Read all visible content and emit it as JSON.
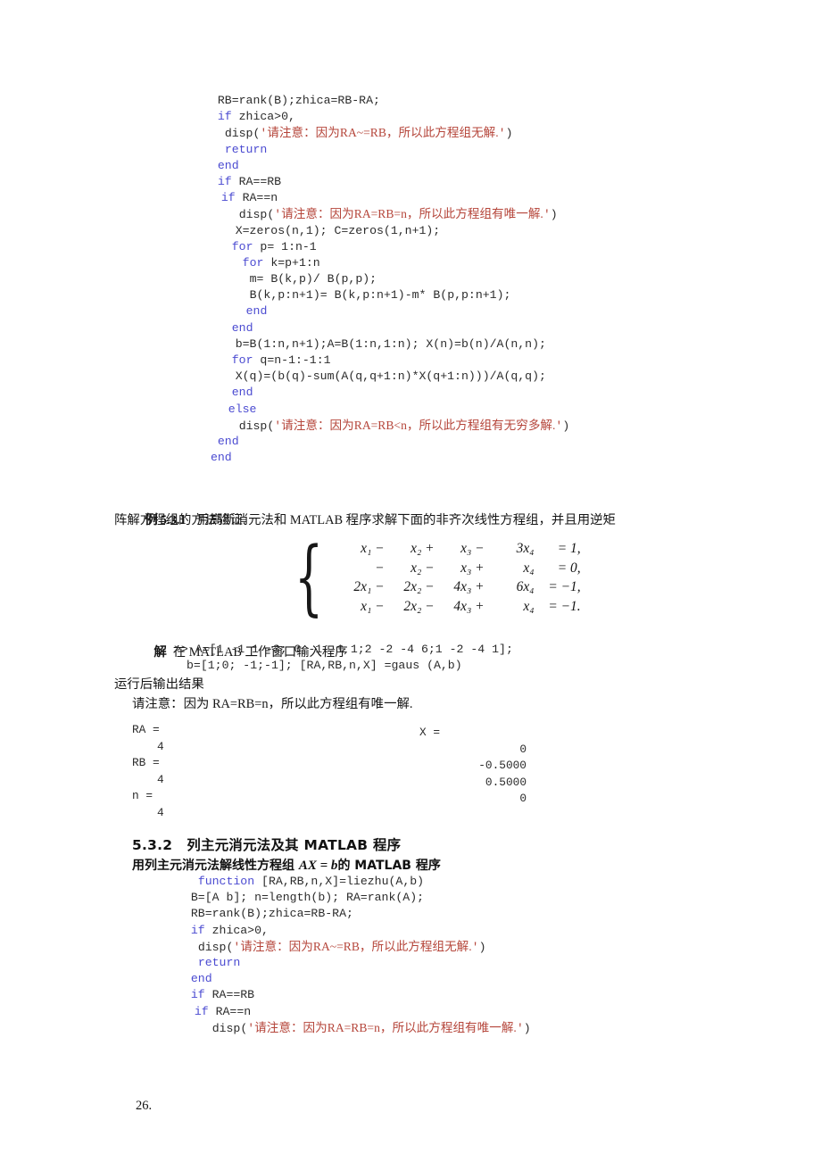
{
  "document": {
    "page_number": "26.",
    "colors": {
      "keyword_blue": "#4b4bd1",
      "string_red": "#b5453a",
      "body_text": "#161616",
      "page_background": "#ffffff"
    }
  },
  "code_block_top": {
    "name": "gauss-function-continuation",
    "lines": [
      {
        "indent": 2,
        "segments": [
          {
            "text": "RB=rank(B);zhica=RB-RA;",
            "style": "plain"
          }
        ]
      },
      {
        "indent": 2,
        "segments": [
          {
            "text": "if",
            "style": "kw"
          },
          {
            "text": " zhica>0,",
            "style": "plain"
          }
        ]
      },
      {
        "indent": 3,
        "segments": [
          {
            "text": "disp(",
            "style": "plain"
          },
          {
            "text": "'",
            "style": "str-q"
          },
          {
            "text": "请注意：因为RA~=RB，所以此方程组无解.",
            "style": "str-cn"
          },
          {
            "text": "'",
            "style": "str-q"
          },
          {
            "text": ")",
            "style": "plain"
          }
        ]
      },
      {
        "indent": 3,
        "segments": [
          {
            "text": "return",
            "style": "kw"
          }
        ]
      },
      {
        "indent": 2,
        "segments": [
          {
            "text": "end",
            "style": "kw"
          }
        ]
      },
      {
        "indent": 2,
        "segments": [
          {
            "text": "if",
            "style": "kw"
          },
          {
            "text": " RA==RB",
            "style": "plain"
          }
        ]
      },
      {
        "indent": 2.5,
        "segments": [
          {
            "text": "if",
            "style": "kw"
          },
          {
            "text": " RA==n",
            "style": "plain"
          }
        ]
      },
      {
        "indent": 5,
        "segments": [
          {
            "text": "disp(",
            "style": "plain"
          },
          {
            "text": "'",
            "style": "str-q"
          },
          {
            "text": "请注意：因为RA=RB=n，所以此方程组有唯一解.",
            "style": "str-cn"
          },
          {
            "text": "'",
            "style": "str-q"
          },
          {
            "text": ")",
            "style": "plain"
          }
        ]
      },
      {
        "indent": 4.5,
        "segments": [
          {
            "text": "X=zeros(n,1); C=zeros(1,n+1);",
            "style": "plain"
          }
        ]
      },
      {
        "indent": 4,
        "segments": [
          {
            "text": "for",
            "style": "kw"
          },
          {
            "text": " p= 1:n-1",
            "style": "plain"
          }
        ]
      },
      {
        "indent": 5.5,
        "segments": [
          {
            "text": "for",
            "style": "kw"
          },
          {
            "text": " k=p+1:n",
            "style": "plain"
          }
        ]
      },
      {
        "indent": 6.5,
        "segments": [
          {
            "text": "m= B(k,p)/ B(p,p);",
            "style": "plain"
          }
        ]
      },
      {
        "indent": 6.5,
        "segments": [
          {
            "text": "B(k,p:n+1)= B(k,p:n+1)-m* B(p,p:n+1);",
            "style": "plain"
          }
        ]
      },
      {
        "indent": 6,
        "segments": [
          {
            "text": "end",
            "style": "kw"
          }
        ]
      },
      {
        "indent": 4,
        "segments": [
          {
            "text": "end",
            "style": "kw"
          }
        ]
      },
      {
        "indent": 4.5,
        "segments": [
          {
            "text": "b=B(1:n,n+1);A=B(1:n,1:n); X(n)=b(n)/A(n,n);",
            "style": "plain"
          }
        ]
      },
      {
        "indent": 4,
        "segments": [
          {
            "text": "for",
            "style": "kw"
          },
          {
            "text": " q=n-1:-1:1",
            "style": "plain"
          }
        ]
      },
      {
        "indent": 4.5,
        "segments": [
          {
            "text": "X(q)=(b(q)-sum(A(q,q+1:n)*X(q+1:n)))/A(q,q);",
            "style": "plain"
          }
        ]
      },
      {
        "indent": 4,
        "segments": [
          {
            "text": "end",
            "style": "kw"
          }
        ]
      },
      {
        "indent": 3.5,
        "segments": [
          {
            "text": "else",
            "style": "kw"
          }
        ]
      },
      {
        "indent": 5,
        "segments": [
          {
            "text": "disp(",
            "style": "plain"
          },
          {
            "text": "'",
            "style": "str-q"
          },
          {
            "text": "请注意：因为RA=RB<n，所以此方程组有无穷多解.",
            "style": "str-cn"
          },
          {
            "text": "'",
            "style": "str-q"
          },
          {
            "text": ")",
            "style": "plain"
          }
        ]
      },
      {
        "indent": 2,
        "segments": [
          {
            "text": "end",
            "style": "kw"
          }
        ]
      },
      {
        "indent": 1,
        "segments": [
          {
            "text": "end",
            "style": "kw"
          }
        ]
      }
    ]
  },
  "example": {
    "label_bold": "例",
    "number": "5.3.1",
    "line1_rest": "用高斯消元法和 MATLAB 程序求解下面的非齐次线性方程组，并且用逆矩",
    "line2": "阵解方程组的方法验证."
  },
  "equations": {
    "rows": [
      {
        "c1": "x₁ −",
        "c2": "x₂ +",
        "c3": "x₃ −",
        "c4": "3x₄",
        "c5": "= 1,"
      },
      {
        "c1": "−",
        "c2": "x₂ −",
        "c3": "x₃ +",
        "c4": "x₄",
        "c5": "= 0,"
      },
      {
        "c1": "2x₁ −",
        "c2": "2x₂ −",
        "c3": "4x₃ +",
        "c4": "6x₄",
        "c5": "= −1,"
      },
      {
        "c1": "x₁ −",
        "c2": "2x₂ −",
        "c3": "4x₃ +",
        "c4": "x₄",
        "c5": "= −1."
      }
    ]
  },
  "solution": {
    "label_bold": "解",
    "intro": "在 MATLAB 工作窗口输入程序",
    "cmd_line1": ">> A=[1 -1 1 -3; 0 -1 -1 1;2 -2 -4 6;1 -2 -4 1];",
    "cmd_line2": "b=[1;0; -1;-1]; [RA,RB,n,X] =gaus (A,b)",
    "run_label": "运行后输出结果",
    "notice": "请注意：因为 RA=RB=n，所以此方程组有唯一解."
  },
  "console_output": {
    "left_column": [
      {
        "label": "RA =",
        "value": "4"
      },
      {
        "label": "RB =",
        "value": "4"
      },
      {
        "label": "n =",
        "value": "4"
      }
    ],
    "right_column": {
      "label": "X =",
      "values": [
        "0",
        "-0.5000",
        "0.5000",
        "0"
      ]
    }
  },
  "section_532": {
    "number": "5.3.2",
    "title": "列主元消元法及其 MATLAB 程序",
    "subtitle_pre": "用列主元消元法解线性方程组 ",
    "subtitle_math": "AX = b",
    "subtitle_post": "的 MATLAB 程序"
  },
  "code_block_bottom": {
    "name": "liezhu-function",
    "lines": [
      {
        "indent": 3,
        "segments": [
          {
            "text": "function",
            "style": "kw"
          },
          {
            "text": " [RA,RB,n,X]=liezhu(A,b)",
            "style": "plain"
          }
        ]
      },
      {
        "indent": 2,
        "segments": [
          {
            "text": "B=[A b]; n=length(b); RA=rank(A);",
            "style": "plain"
          }
        ]
      },
      {
        "indent": 2,
        "segments": [
          {
            "text": "RB=rank(B);zhica=RB-RA;",
            "style": "plain"
          }
        ]
      },
      {
        "indent": 2,
        "segments": [
          {
            "text": "if",
            "style": "kw"
          },
          {
            "text": " zhica>0,",
            "style": "plain"
          }
        ]
      },
      {
        "indent": 3,
        "segments": [
          {
            "text": "disp(",
            "style": "plain"
          },
          {
            "text": "'",
            "style": "str-q"
          },
          {
            "text": "请注意：因为RA~=RB，所以此方程组无解.",
            "style": "str-cn"
          },
          {
            "text": "'",
            "style": "str-q"
          },
          {
            "text": ")",
            "style": "plain"
          }
        ]
      },
      {
        "indent": 3,
        "segments": [
          {
            "text": "return",
            "style": "kw"
          }
        ]
      },
      {
        "indent": 2,
        "segments": [
          {
            "text": "end",
            "style": "kw"
          }
        ]
      },
      {
        "indent": 2,
        "segments": [
          {
            "text": "if",
            "style": "kw"
          },
          {
            "text": " RA==RB",
            "style": "plain"
          }
        ]
      },
      {
        "indent": 2.5,
        "segments": [
          {
            "text": "if",
            "style": "kw"
          },
          {
            "text": " RA==n",
            "style": "plain"
          }
        ]
      },
      {
        "indent": 5,
        "segments": [
          {
            "text": "disp(",
            "style": "plain"
          },
          {
            "text": "'",
            "style": "str-q"
          },
          {
            "text": "请注意：因为RA=RB=n，所以此方程组有唯一解.",
            "style": "str-cn"
          },
          {
            "text": "'",
            "style": "str-q"
          },
          {
            "text": ")",
            "style": "plain"
          }
        ]
      }
    ]
  }
}
